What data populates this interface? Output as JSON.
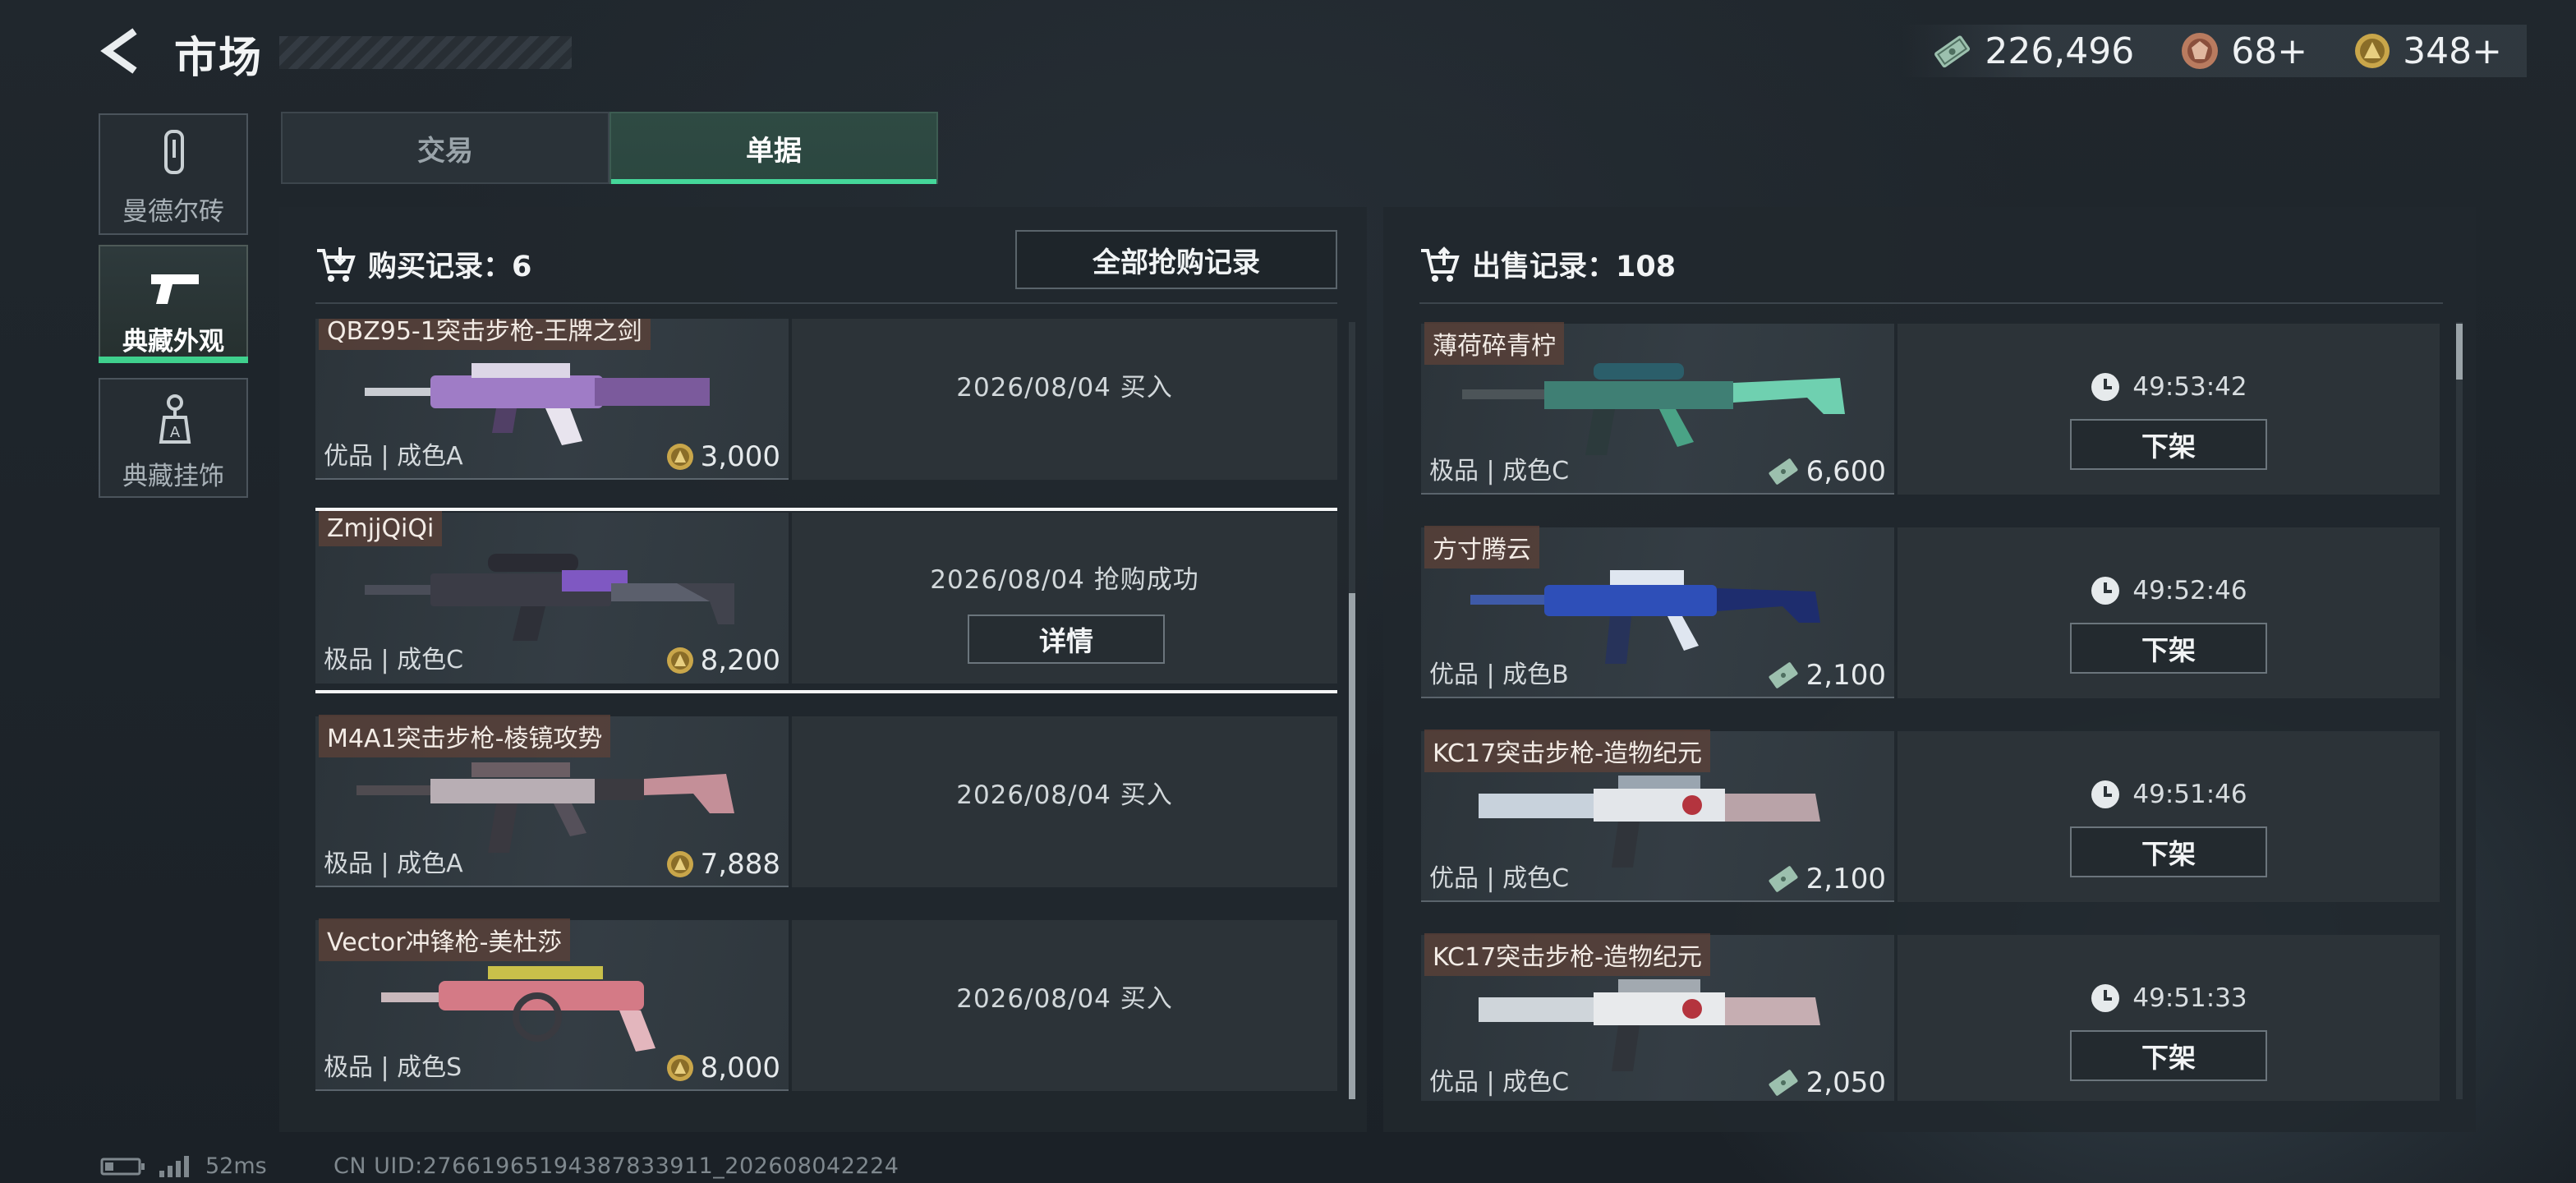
{
  "header": {
    "title": "市场",
    "back_icon": "back-arrow-icon",
    "currency": [
      {
        "icon": "cash-icon",
        "value": "226,496"
      },
      {
        "icon": "bronze-coin-icon",
        "value": "68+"
      },
      {
        "icon": "gold-coin-icon",
        "value": "348+"
      }
    ]
  },
  "sidebar": {
    "items": [
      {
        "label": "曼德尔砖",
        "icon": "mandel-brick-icon"
      },
      {
        "label": "典藏外观",
        "icon": "pistol-icon"
      },
      {
        "label": "典藏挂饰",
        "icon": "charm-icon"
      }
    ]
  },
  "tabs": [
    {
      "label": "交易"
    },
    {
      "label": "单据"
    }
  ],
  "buy": {
    "header": "购买记录：6",
    "all_button": "全部抢购记录",
    "rows": [
      {
        "name": "QBZ95-1突击步枪-王牌之剑",
        "grade": "优品 | 成色A",
        "price": "3,000",
        "status": "2026/08/04 买入"
      },
      {
        "name": "ZmjjQiQi",
        "grade": "极品 | 成色C",
        "price": "8,200",
        "status": "2026/08/04 抢购成功",
        "button": "详情"
      },
      {
        "name": "M4A1突击步枪-棱镜攻势",
        "grade": "极品 | 成色A",
        "price": "7,888",
        "status": "2026/08/04 买入"
      },
      {
        "name": "Vector冲锋枪-美杜莎",
        "grade": "极品 | 成色S",
        "price": "8,000",
        "status": "2026/08/04 买入"
      }
    ]
  },
  "sell": {
    "header": "出售记录：108",
    "rows": [
      {
        "name": "薄荷碎青柠",
        "grade": "极品 | 成色C",
        "price": "6,600",
        "timer": "49:53:42",
        "button": "下架"
      },
      {
        "name": "方寸腾云",
        "grade": "优品 | 成色B",
        "price": "2,100",
        "timer": "49:52:46",
        "button": "下架"
      },
      {
        "name": "KC17突击步枪-造物纪元",
        "grade": "优品 | 成色C",
        "price": "2,100",
        "timer": "49:51:46",
        "button": "下架"
      },
      {
        "name": "KC17突击步枪-造物纪元",
        "grade": "优品 | 成色C",
        "price": "2,050",
        "timer": "49:51:33",
        "button": "下架"
      }
    ]
  },
  "footer": {
    "ping": "52ms",
    "uid": "CN UID:27661965194387833911_202608042224"
  },
  "colors": {
    "accent_green": "#3fd08d",
    "gold": "#c9a64a",
    "cash": "#8fb8a4"
  }
}
